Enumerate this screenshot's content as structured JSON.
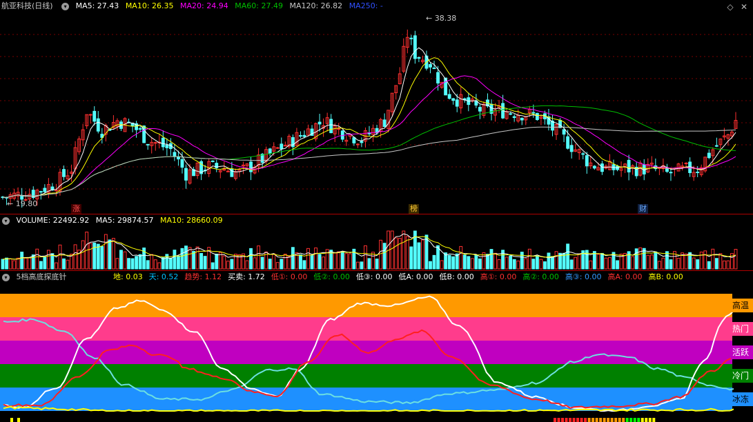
{
  "price_header": {
    "title": "航亚科技(日线)",
    "ma5": "MA5: 27.43",
    "ma10": "MA10: 26.35",
    "ma20": "MA20: 24.94",
    "ma60": "MA60: 27.49",
    "ma120": "MA120: 26.82",
    "ma250": "MA250: -"
  },
  "price_chart": {
    "high_label": "38.38",
    "low_label": "19.80",
    "markers": [
      "涨",
      "榜",
      "财"
    ]
  },
  "volume_header": {
    "volume": "VOLUME: 22492.92",
    "ma5": "MA5: 29874.57",
    "ma10": "MA10: 28660.09"
  },
  "indicator_header": {
    "name": "5档高底探底针",
    "items": [
      {
        "text": "地: 0.03",
        "color": "#ffff00"
      },
      {
        "text": "天: 0.52",
        "color": "#00c0ff"
      },
      {
        "text": "趋势: 1.12",
        "color": "#ff3030"
      },
      {
        "text": "买卖: 1.72",
        "color": "#ffffff"
      },
      {
        "text": "低①: 0.00",
        "color": "#ff3030"
      },
      {
        "text": "低②: 0.00",
        "color": "#00c000"
      },
      {
        "text": "低③: 0.00",
        "color": "#ffffff"
      },
      {
        "text": "低A: 0.00",
        "color": "#ffffff"
      },
      {
        "text": "低B: 0.00",
        "color": "#ffffff"
      },
      {
        "text": "高①: 0.00",
        "color": "#ff3030"
      },
      {
        "text": "高②: 0.00",
        "color": "#00c000"
      },
      {
        "text": "高③: 0.00",
        "color": "#3399ff"
      },
      {
        "text": "高A: 0.00",
        "color": "#ff3030"
      },
      {
        "text": "高B: 0.00",
        "color": "#ffff00"
      }
    ]
  },
  "zones": [
    {
      "label": "高温",
      "color": "#ff9900",
      "text_color": "#000000"
    },
    {
      "label": "热门",
      "color": "#ff3c8c",
      "text_color": "#ffffff"
    },
    {
      "label": "活跃",
      "color": "#c000c0",
      "text_color": "#ffffff"
    },
    {
      "label": "冷门",
      "color": "#008000",
      "text_color": "#ffffff"
    },
    {
      "label": "冰冻",
      "color": "#1e90ff",
      "text_color": "#000000"
    }
  ],
  "colors": {
    "ma5": "#ffffff",
    "ma10": "#ffff00",
    "ma20": "#ff00ff",
    "ma60": "#00c000",
    "ma120": "#c8c8c8",
    "ma250": "#0000ff",
    "up": "#ff3030",
    "down": "#54ffff"
  }
}
